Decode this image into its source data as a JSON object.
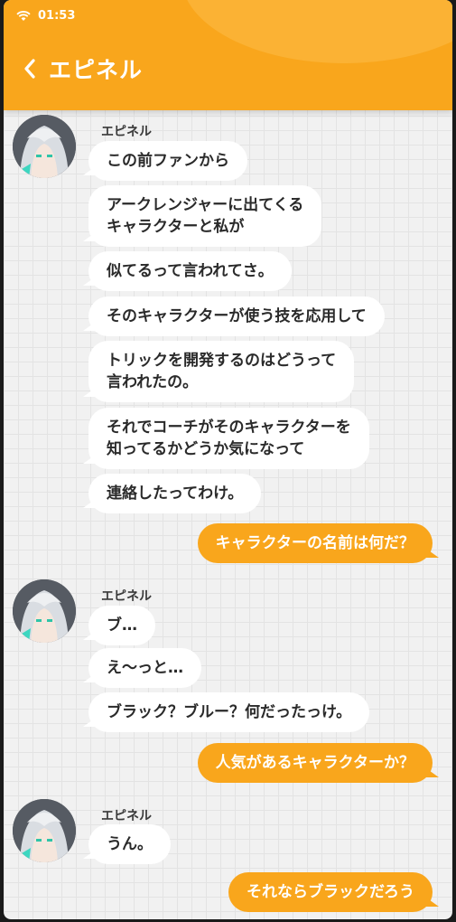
{
  "status": {
    "time": "01:53"
  },
  "header": {
    "title": "エピネル"
  },
  "colors": {
    "accent": "#f9a61c",
    "background": "#f1f1f1"
  },
  "messages": {
    "g1": {
      "sender": "エピネル",
      "m1": "この前ファンから",
      "m2": "アークレンジャーに出てくる\nキャラクターと私が",
      "m3": "似てるって言われてさ。",
      "m4": "そのキャラクターが使う技を応用して",
      "m5": "トリックを開発するのはどうって\n言われたの。",
      "m6": "それでコーチがそのキャラクターを\n知ってるかどうか気になって",
      "m7": "連絡したってわけ。"
    },
    "s1": "キャラクターの名前は何だ？",
    "g2": {
      "sender": "エピネル",
      "m1": "ブ…",
      "m2": "え～っと…",
      "m3": "ブラック？ブルー？何だったっけ。"
    },
    "s2": "人気があるキャラクターか？",
    "g3": {
      "sender": "エピネル",
      "m1": "うん。"
    },
    "s3": "それならブラックだろう"
  }
}
